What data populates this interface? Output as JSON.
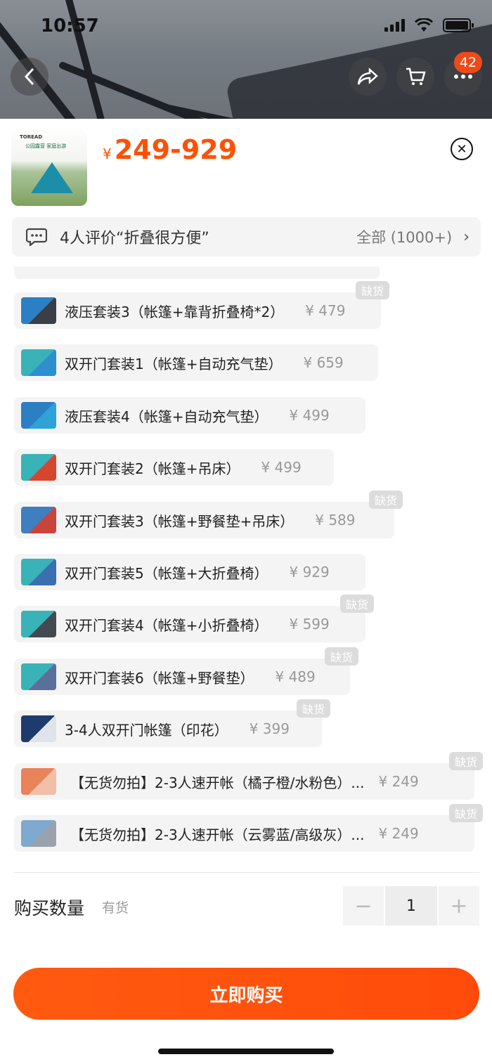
{
  "status_bar": {
    "time": "10:57"
  },
  "header": {
    "cart_badge": "42"
  },
  "product": {
    "thumb_brand": "TOREAD",
    "thumb_banner": "公园露营 家庭出游",
    "currency": "¥",
    "price_range": "249-929"
  },
  "review": {
    "text": "4人评价“折叠很方便”",
    "all_label": "全部 (1000+)"
  },
  "options": [
    {
      "label": "液压套装3（帐篷+靠背折叠椅*2）",
      "price": "¥ 479",
      "out_of_stock": true,
      "thumb_colors": [
        "#2d7fc4",
        "#3a3f47"
      ]
    },
    {
      "label": "双开门套装1（帐篷+自动充气垫）",
      "price": "¥ 659",
      "out_of_stock": false,
      "thumb_colors": [
        "#39b3b8",
        "#2d8fd0"
      ]
    },
    {
      "label": "液压套装4（帐篷+自动充气垫）",
      "price": "¥ 499",
      "out_of_stock": false,
      "thumb_colors": [
        "#2d7fc4",
        "#2da3d8"
      ]
    },
    {
      "label": "双开门套装2（帐篷+吊床）",
      "price": "¥ 499",
      "out_of_stock": false,
      "thumb_colors": [
        "#39b3b8",
        "#d8452f"
      ]
    },
    {
      "label": "双开门套装3（帐篷+野餐垫+吊床）",
      "price": "¥ 589",
      "out_of_stock": true,
      "thumb_colors": [
        "#3f7fc0",
        "#c8453b"
      ]
    },
    {
      "label": "双开门套装5（帐篷+大折叠椅）",
      "price": "¥ 929",
      "out_of_stock": false,
      "thumb_colors": [
        "#39b3b8",
        "#3a6fb0"
      ]
    },
    {
      "label": "双开门套装4（帐篷+小折叠椅）",
      "price": "¥ 599",
      "out_of_stock": true,
      "thumb_colors": [
        "#39b3b8",
        "#444a52"
      ]
    },
    {
      "label": "双开门套装6（帐篷+野餐垫）",
      "price": "¥ 489",
      "out_of_stock": true,
      "thumb_colors": [
        "#39b3b8",
        "#5a6f9a"
      ]
    },
    {
      "label": "3-4人双开门帐篷（印花）",
      "price": "¥ 399",
      "out_of_stock": true,
      "thumb_colors": [
        "#1f3b6e",
        "#e0e3ea"
      ]
    },
    {
      "label": "【无货勿拍】2-3人速开帐（橘子橙/水粉色）...",
      "price": "¥ 249",
      "out_of_stock": true,
      "thumb_colors": [
        "#e8835a",
        "#f2c0a8"
      ]
    },
    {
      "label": "【无货勿拍】2-3人速开帐（云雾蓝/高级灰）...",
      "price": "¥ 249",
      "out_of_stock": true,
      "thumb_colors": [
        "#7fa9cf",
        "#9aa3ad"
      ]
    }
  ],
  "oos_label": "缺货",
  "quantity": {
    "label": "购买数量",
    "stock_status": "有货",
    "value": "1",
    "minus": "−",
    "plus": "+"
  },
  "buy_button": "立即购买",
  "colors": {
    "accent": "#ff5000",
    "chip_bg": "#f4f4f4"
  }
}
